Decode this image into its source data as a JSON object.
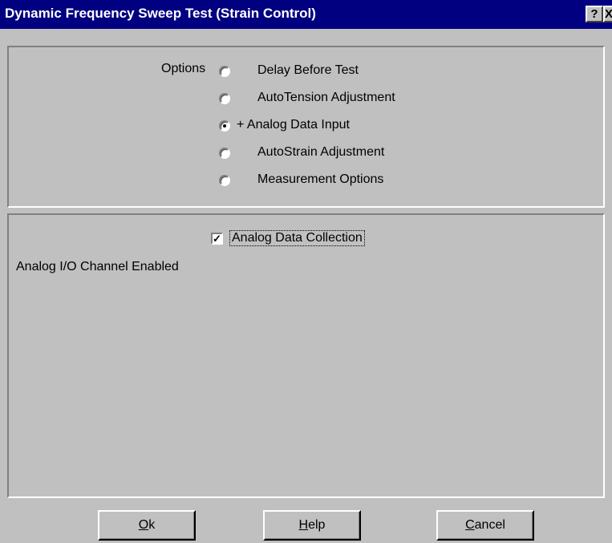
{
  "window": {
    "title": "Dynamic Frequency Sweep Test (Strain Control)",
    "help_button": "?",
    "close_button": "X"
  },
  "options": {
    "label": "Options",
    "items": [
      {
        "label": "Delay Before Test",
        "checked": false
      },
      {
        "label": "AutoTension Adjustment",
        "checked": false
      },
      {
        "label": "+ Analog Data Input",
        "checked": true
      },
      {
        "label": "AutoStrain Adjustment",
        "checked": false
      },
      {
        "label": "Measurement Options",
        "checked": false
      }
    ]
  },
  "analog": {
    "checkbox_label": "Analog Data Collection",
    "checkbox_checked": true,
    "status_text": "Analog I/O Channel Enabled"
  },
  "buttons": {
    "ok": {
      "accel": "O",
      "rest": "k"
    },
    "help": {
      "accel": "H",
      "rest": "elp"
    },
    "cancel": {
      "accel": "C",
      "rest": "ancel"
    }
  }
}
